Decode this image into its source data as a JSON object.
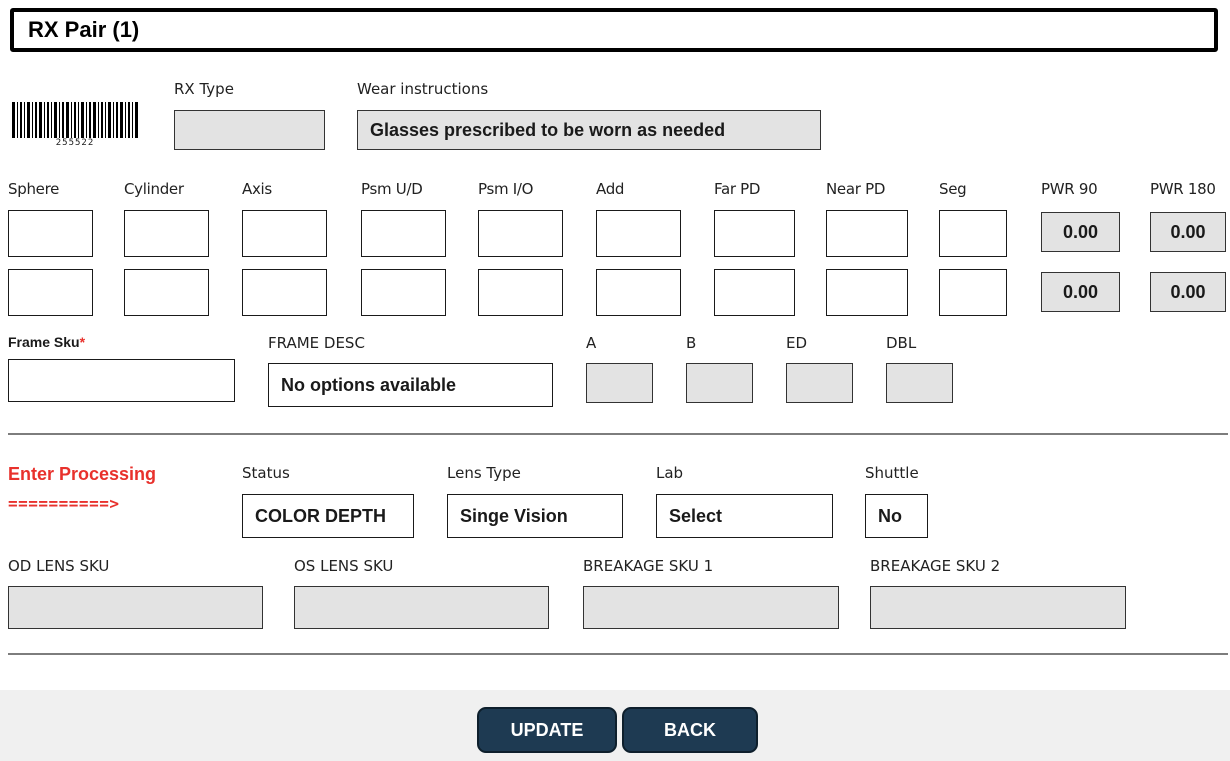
{
  "title": "RX Pair (1)",
  "barcode_number": "255522",
  "rx_type": {
    "label": "RX Type",
    "value": ""
  },
  "wear_instructions": {
    "label": "Wear instructions",
    "value": "Glasses prescribed to be worn as needed"
  },
  "rx_columns": [
    "Sphere",
    "Cylinder",
    "Axis",
    "Psm U/D",
    "Psm I/O",
    "Add",
    "Far PD",
    "Near PD",
    "Seg",
    "PWR 90",
    "PWR 180"
  ],
  "pwr": {
    "od_90": "0.00",
    "od_180": "0.00",
    "os_90": "0.00",
    "os_180": "0.00"
  },
  "frame": {
    "sku_label": "Frame Sku",
    "required_mark": "*",
    "desc_label": "FRAME DESC",
    "desc_value": "No options available",
    "a_label": "A",
    "b_label": "B",
    "ed_label": "ED",
    "dbl_label": "DBL"
  },
  "processing": {
    "heading": "Enter Processing",
    "arrow": "==========>",
    "status_label": "Status",
    "status_value": "COLOR DEPTH",
    "lens_type_label": "Lens Type",
    "lens_type_value": "Singe Vision",
    "lab_label": "Lab",
    "lab_value": "Select",
    "shuttle_label": "Shuttle",
    "shuttle_value": "No"
  },
  "skus": {
    "od_label": "OD LENS SKU",
    "os_label": "OS LENS SKU",
    "breakage1_label": "BREAKAGE SKU 1",
    "breakage2_label": "BREAKAGE SKU 2"
  },
  "buttons": {
    "update": "UPDATE",
    "back": "BACK"
  },
  "colors": {
    "accent_red": "#e8312c",
    "button_navy": "#1e3a52",
    "readonly_gray": "#e3e3e3"
  }
}
